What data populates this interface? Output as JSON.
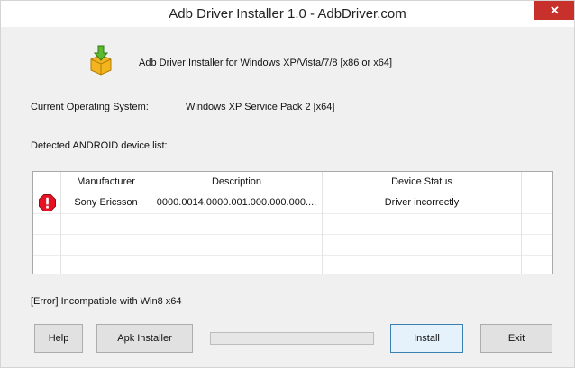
{
  "window": {
    "title": "Adb Driver Installer 1.0  -  AdbDriver.com",
    "close_glyph": "✕"
  },
  "header": {
    "icon": "package-install-icon",
    "text": "Adb Driver Installer for Windows XP/Vista/7/8 [x86 or x64]"
  },
  "os": {
    "label": "Current Operating System:",
    "value": "Windows XP Service Pack 2 [x64]"
  },
  "device_list": {
    "label": "Detected ANDROID device list:",
    "columns": [
      "Manufacturer",
      "Description",
      "Device Status"
    ],
    "rows": [
      {
        "status_icon": "error-stop-icon",
        "manufacturer": "Sony Ericsson",
        "description": "0000.0014.0000.001.000.000.000....",
        "status": "Driver incorrectly"
      }
    ]
  },
  "error_message": "[Error] Incompatible with Win8 x64",
  "buttons": {
    "help": "Help",
    "apk_installer": "Apk Installer",
    "install": "Install",
    "exit": "Exit"
  },
  "progress": 0,
  "colors": {
    "close_button": "#c7302b",
    "stop_icon": "#e81123",
    "progress_fill": "#06b025"
  }
}
